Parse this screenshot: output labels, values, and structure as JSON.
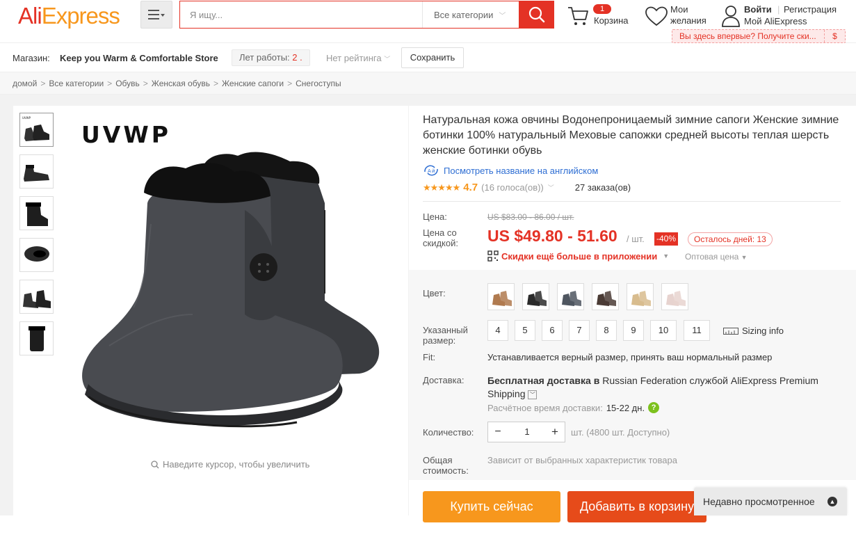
{
  "header": {
    "logo_ali": "Ali",
    "logo_express": "Express",
    "search_placeholder": "Я ищу...",
    "category_select": "Все категории",
    "cart_count": "1",
    "cart_label": "Корзина",
    "wishlist_label_1": "Мои",
    "wishlist_label_2": "желания",
    "signin": "Войти",
    "register": "Регистрация",
    "my_account": "Мой AliExpress",
    "promo_text": "Вы здесь впервые? Получите ски...",
    "promo_icon": "$"
  },
  "store": {
    "label": "Магазин:",
    "name": "Keep you Warm & Comfortable Store",
    "years_label": "Лет работы:",
    "years_value": "2 .",
    "rating": "Нет рейтинга",
    "save": "Сохранить"
  },
  "breadcrumb": [
    "домой",
    "Все категории",
    "Обувь",
    "Женская обувь",
    "Женские сапоги",
    "Снегоступы"
  ],
  "gallery": {
    "brand": "UVWP",
    "zoom_hint": "Наведите курсор, чтобы увеличить"
  },
  "product": {
    "title": "Натуральная кожа овчины Водонепроницаемый зимние сапоги Женские зимние ботинки 100% натуральный Меховые сапожки средней высоты теплая шерсть женские ботинки обувь",
    "view_english": "Посмотреть название на английском",
    "stars": "★★★★★",
    "rating": "4.7",
    "votes": "(16 голоса(ов))",
    "orders": "27 заказа(ов)",
    "price_label": "Цена:",
    "old_price": "US $83.00 - 86.00 / шт.",
    "discount_price_label": "Цена со скидкой:",
    "price": "US $49.80 - 51.60",
    "unit": "/ шт.",
    "discount": "-40%",
    "days_left": "Осталось дней: 13",
    "app_promo": "Скидки ещё больше в приложении",
    "wholesale": "Оптовая цена",
    "color_label": "Цвет:",
    "colors": [
      "#b07a4f",
      "#2b2b2b",
      "#4f5660",
      "#4a3b35",
      "#d8bc8e",
      "#e7d3cf"
    ],
    "size_label": "Указанный размер:",
    "sizes": [
      "4",
      "5",
      "6",
      "7",
      "8",
      "9",
      "10",
      "11"
    ],
    "sizing_info": "Sizing info",
    "fit_label": "Fit:",
    "fit_value": "Устанавливается верный размер, принять ваш нормальный размер",
    "delivery_label": "Доставка:",
    "delivery_bold": "Бесплатная доставка в",
    "delivery_rest": "Russian Federation службой AliExpress Premium Shipping",
    "delivery_time_label": "Расчётное время доставки:",
    "delivery_time_value": "15-22 дн.",
    "qty_label": "Количество:",
    "qty_value": "1",
    "qty_available": "шт. (4800 шт. Доступно)",
    "total_label": "Общая стоимость:",
    "total_value": "Зависит от выбранных характеристик товара",
    "buy_now": "Купить сейчас",
    "add_to_cart": "Добавить в корзину"
  },
  "recently_viewed": "Недавно просмотренное",
  "colors": {
    "brand_red": "#e43225",
    "brand_orange": "#f7971d"
  }
}
